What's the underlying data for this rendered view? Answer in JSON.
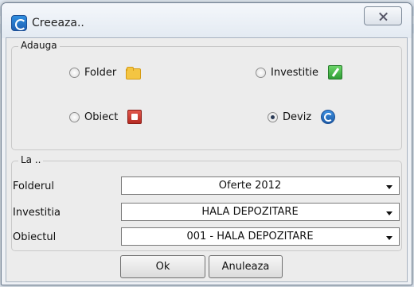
{
  "window": {
    "title": "Creeaza.."
  },
  "adauga": {
    "legend": "Adauga",
    "options": [
      {
        "label": "Folder",
        "icon": "folder-icon",
        "checked": false
      },
      {
        "label": "Investitie",
        "icon": "investitie-icon",
        "checked": false
      },
      {
        "label": "Obiect",
        "icon": "obiect-icon",
        "checked": false
      },
      {
        "label": "Deviz",
        "icon": "deviz-icon",
        "checked": true
      }
    ]
  },
  "la": {
    "legend": "La ..",
    "rows": [
      {
        "label": "Folderul",
        "value": "Oferte 2012"
      },
      {
        "label": "Investitia",
        "value": "HALA DEPOZITARE"
      },
      {
        "label": "Obiectul",
        "value": "001 - HALA DEPOZITARE"
      }
    ]
  },
  "buttons": {
    "ok": "Ok",
    "cancel": "Anuleaza"
  }
}
